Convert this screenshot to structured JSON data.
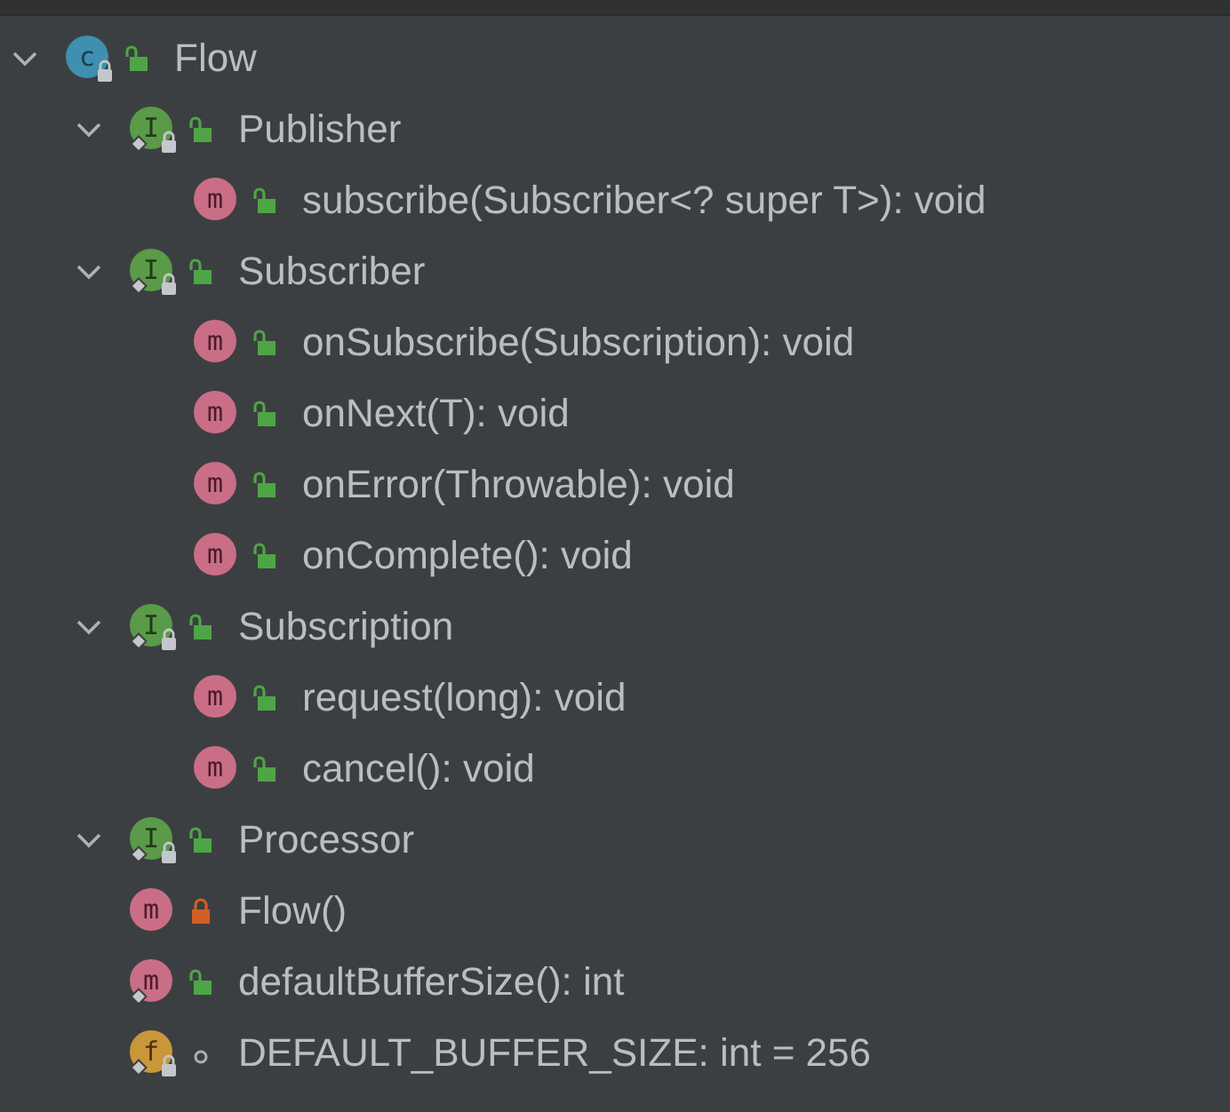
{
  "tree": [
    {
      "label": "Flow",
      "kind": "class",
      "icon_letter": "c",
      "private": false,
      "package": false,
      "final": true,
      "static": false,
      "expanded": true,
      "children": [
        {
          "label": "Publisher",
          "kind": "interface",
          "icon_letter": "I",
          "private": false,
          "package": false,
          "final": true,
          "static": true,
          "expanded": true,
          "children": [
            {
              "label": "subscribe(Subscriber<? super T>): void",
              "kind": "method",
              "icon_letter": "m",
              "private": false,
              "package": false,
              "final": false,
              "static": false
            }
          ]
        },
        {
          "label": "Subscriber",
          "kind": "interface",
          "icon_letter": "I",
          "private": false,
          "package": false,
          "final": true,
          "static": true,
          "expanded": true,
          "children": [
            {
              "label": "onSubscribe(Subscription): void",
              "kind": "method",
              "icon_letter": "m",
              "private": false,
              "package": false,
              "final": false,
              "static": false
            },
            {
              "label": "onNext(T): void",
              "kind": "method",
              "icon_letter": "m",
              "private": false,
              "package": false,
              "final": false,
              "static": false
            },
            {
              "label": "onError(Throwable): void",
              "kind": "method",
              "icon_letter": "m",
              "private": false,
              "package": false,
              "final": false,
              "static": false
            },
            {
              "label": "onComplete(): void",
              "kind": "method",
              "icon_letter": "m",
              "private": false,
              "package": false,
              "final": false,
              "static": false
            }
          ]
        },
        {
          "label": "Subscription",
          "kind": "interface",
          "icon_letter": "I",
          "private": false,
          "package": false,
          "final": true,
          "static": true,
          "expanded": true,
          "children": [
            {
              "label": "request(long): void",
              "kind": "method",
              "icon_letter": "m",
              "private": false,
              "package": false,
              "final": false,
              "static": false
            },
            {
              "label": "cancel(): void",
              "kind": "method",
              "icon_letter": "m",
              "private": false,
              "package": false,
              "final": false,
              "static": false
            }
          ]
        },
        {
          "label": "Processor",
          "kind": "interface",
          "icon_letter": "I",
          "private": false,
          "package": false,
          "final": true,
          "static": true,
          "expanded": true
        },
        {
          "label": "Flow()",
          "kind": "method",
          "icon_letter": "m",
          "private": true,
          "package": false,
          "final": false,
          "static": false
        },
        {
          "label": "defaultBufferSize(): int",
          "kind": "method",
          "icon_letter": "m",
          "private": false,
          "package": false,
          "final": false,
          "static": true
        },
        {
          "label": "DEFAULT_BUFFER_SIZE: int = 256",
          "kind": "field",
          "icon_letter": "f",
          "private": false,
          "package": true,
          "final": true,
          "static": true
        }
      ]
    }
  ]
}
